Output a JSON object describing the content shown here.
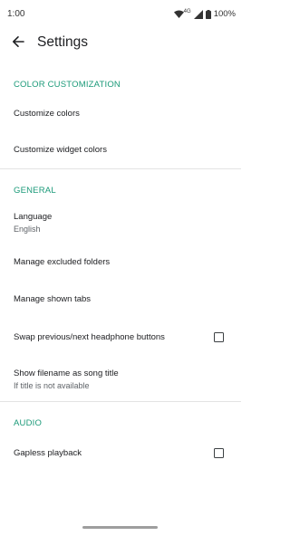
{
  "status": {
    "time": "1:00",
    "network": "4G",
    "battery": "100%"
  },
  "header": {
    "title": "Settings",
    "back_icon": "arrow-back-icon"
  },
  "accent_color": "#1b9a79",
  "sections": {
    "color": {
      "header": "COLOR CUSTOMIZATION",
      "customize_colors": "Customize colors",
      "customize_widget_colors": "Customize widget colors"
    },
    "general": {
      "header": "GENERAL",
      "language_title": "Language",
      "language_value": "English",
      "excluded_folders": "Manage excluded folders",
      "shown_tabs": "Manage shown tabs",
      "swap_buttons": "Swap previous/next headphone buttons",
      "show_filename_title": "Show filename as song title",
      "show_filename_summary": "If title is not available"
    },
    "audio": {
      "header": "AUDIO",
      "gapless": "Gapless playback"
    }
  }
}
